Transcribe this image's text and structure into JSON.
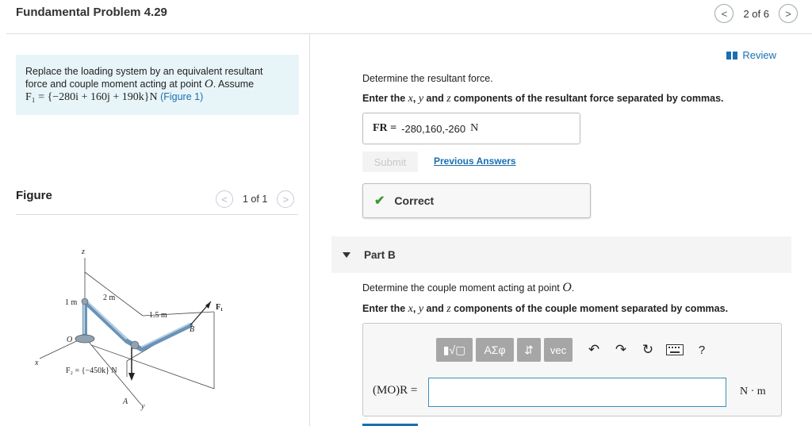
{
  "header": {
    "title": "Fundamental Problem 4.29",
    "pager_text": "2 of 6",
    "prev_glyph": "<",
    "next_glyph": ">"
  },
  "problem": {
    "line1": "Replace the loading system by an equivalent resultant",
    "line2_a": "force and couple moment acting at point ",
    "line2_point": "O",
    "line2_b": ". Assume",
    "force_expr": "F₁ = {−280i + 160j + 190k}N",
    "figure_link": "(Figure 1)"
  },
  "figure": {
    "label": "Figure",
    "pager_text": "1 of 1",
    "labels": {
      "z": "z",
      "x": "x",
      "y": "y",
      "o": "O",
      "a": "A",
      "b": "B",
      "dim_1m": "1 m",
      "dim_2m": "2 m",
      "dim_15m": "1.5 m",
      "f1": "F₁",
      "f2": "F₂ = {−450k} N"
    }
  },
  "review": {
    "label": "Review"
  },
  "part_a": {
    "question": "Determine the resultant force.",
    "instruction_a": "Enter the ",
    "instruction_x": "x",
    "instruction_sep1": ", ",
    "instruction_y": "y",
    "instruction_sep2": " and ",
    "instruction_z": "z",
    "instruction_b": " components of the resultant force separated by commas.",
    "answer_symbol": "FR =",
    "answer_value": "-280,160,-260",
    "answer_unit": "N",
    "submit_label": "Submit",
    "previous_answers_label": "Previous Answers",
    "status_label": "Correct"
  },
  "part_b": {
    "label": "Part B",
    "question_a": "Determine the couple moment acting at point ",
    "question_point": "O",
    "question_b": ".",
    "instruction_a": "Enter the ",
    "instruction_x": "x",
    "instruction_sep1": ", ",
    "instruction_y": "y",
    "instruction_sep2": " and ",
    "instruction_z": "z",
    "instruction_b": " components of the couple moment separated by commas.",
    "input_label": "(MO)R =",
    "input_value": "",
    "unit": "N · m",
    "toolbar": {
      "templates_label": "▮√▢",
      "greek_label": "ΑΣφ",
      "updown_label": "⇵",
      "vec_label": "vec",
      "help_label": "?"
    }
  },
  "colors": {
    "accent": "#1a6fb0",
    "correct_green": "#3a9b2e",
    "problem_bg": "#e8f5f8"
  }
}
